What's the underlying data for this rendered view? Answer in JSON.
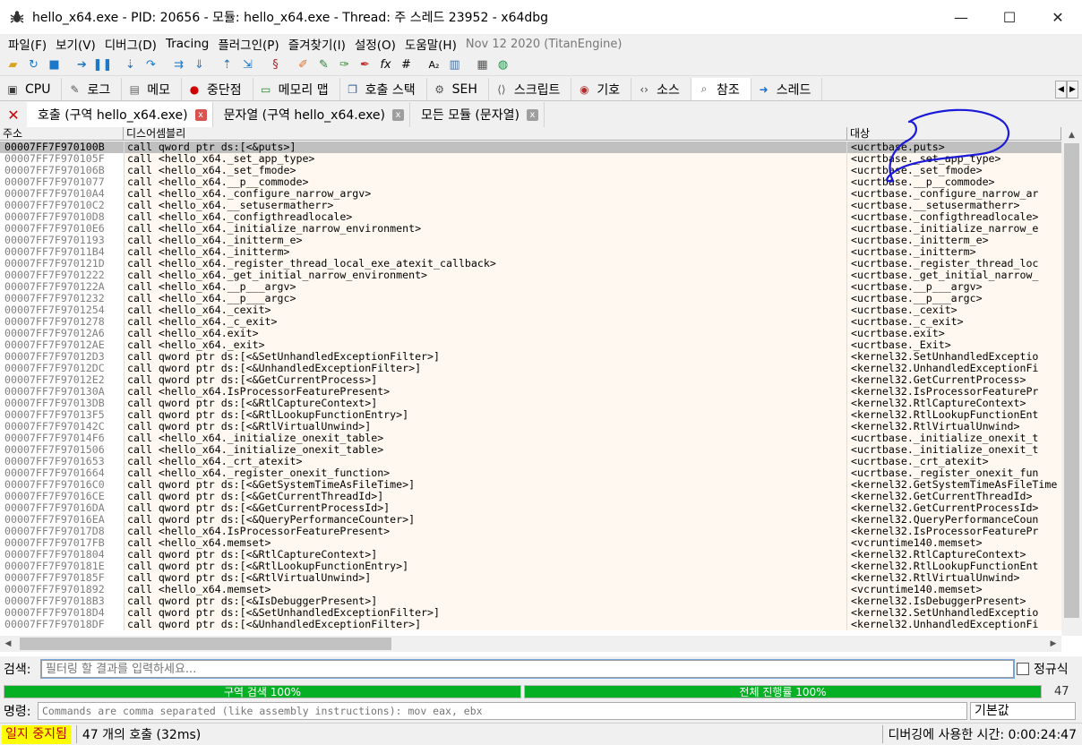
{
  "window": {
    "title": "hello_x64.exe - PID: 20656 - 모듈: hello_x64.exe - Thread: 주 스레드 23952 - x64dbg",
    "minimize": "—",
    "maximize": "☐",
    "close": "✕"
  },
  "menu": {
    "items": [
      "파일(F)",
      "보기(V)",
      "디버그(D)",
      "Tracing",
      "플러그인(P)",
      "즐겨찾기(I)",
      "설정(O)",
      "도움말(H)"
    ],
    "build": "Nov 12 2020 (TitanEngine)"
  },
  "main_tabs": [
    {
      "label": "CPU",
      "icon": "cpu-icon",
      "glyph": "▣",
      "color": "#3a3a3a"
    },
    {
      "label": "로그",
      "icon": "log-icon",
      "glyph": "✎",
      "color": "#555"
    },
    {
      "label": "메모",
      "icon": "notes-icon",
      "glyph": "▤",
      "color": "#666"
    },
    {
      "label": "중단점",
      "icon": "breakpoint-icon",
      "glyph": "●",
      "color": "#d00000"
    },
    {
      "label": "메모리 맵",
      "icon": "memory-map-icon",
      "glyph": "▭",
      "color": "#2e7d32"
    },
    {
      "label": "호출 스택",
      "icon": "call-stack-icon",
      "glyph": "❐",
      "color": "#3060a0"
    },
    {
      "label": "SEH",
      "icon": "seh-icon",
      "glyph": "⚙",
      "color": "#555"
    },
    {
      "label": "스크립트",
      "icon": "script-icon",
      "glyph": "⟨⟩",
      "color": "#555"
    },
    {
      "label": "기호",
      "icon": "symbols-icon",
      "glyph": "◉",
      "color": "#b03030"
    },
    {
      "label": "소스",
      "icon": "source-icon",
      "glyph": "‹›",
      "color": "#444"
    },
    {
      "label": "참조",
      "icon": "references-icon",
      "glyph": "⌕",
      "color": "#555"
    },
    {
      "label": "스레드",
      "icon": "threads-icon",
      "glyph": "➜",
      "color": "#1e6fd0"
    }
  ],
  "sub_tabs": [
    {
      "label": "호출 (구역 hello_x64.exe)",
      "close": "x"
    },
    {
      "label": "문자열 (구역 hello_x64.exe)",
      "close": "x"
    },
    {
      "label": "모든 모듈 (문자열)",
      "close": "x"
    }
  ],
  "columns": {
    "address": "주소",
    "disassembly": "디스어셈블리",
    "target": "대상"
  },
  "rows": [
    {
      "a": "00007FF7F970100B",
      "d": "call qword ptr ds:[<&puts>]",
      "t": "<ucrtbase.puts>"
    },
    {
      "a": "00007FF7F970105F",
      "d": "call <hello_x64._set_app_type>",
      "t": "<ucrtbase._set_app_type>"
    },
    {
      "a": "00007FF7F970106B",
      "d": "call <hello_x64._set_fmode>",
      "t": "<ucrtbase._set_fmode>"
    },
    {
      "a": "00007FF7F9701077",
      "d": "call <hello_x64.__p__commode>",
      "t": "<ucrtbase.__p__commode>"
    },
    {
      "a": "00007FF7F97010A4",
      "d": "call <hello_x64._configure_narrow_argv>",
      "t": "<ucrtbase._configure_narrow_ar"
    },
    {
      "a": "00007FF7F97010C2",
      "d": "call <hello_x64.__setusermatherr>",
      "t": "<ucrtbase.__setusermatherr>"
    },
    {
      "a": "00007FF7F97010D8",
      "d": "call <hello_x64._configthreadlocale>",
      "t": "<ucrtbase._configthreadlocale>"
    },
    {
      "a": "00007FF7F97010E6",
      "d": "call <hello_x64._initialize_narrow_environment>",
      "t": "<ucrtbase._initialize_narrow_e"
    },
    {
      "a": "00007FF7F9701193",
      "d": "call <hello_x64._initterm_e>",
      "t": "<ucrtbase._initterm_e>"
    },
    {
      "a": "00007FF7F97011B4",
      "d": "call <hello_x64._initterm>",
      "t": "<ucrtbase._initterm>"
    },
    {
      "a": "00007FF7F970121D",
      "d": "call <hello_x64._register_thread_local_exe_atexit_callback>",
      "t": "<ucrtbase._register_thread_loc"
    },
    {
      "a": "00007FF7F9701222",
      "d": "call <hello_x64._get_initial_narrow_environment>",
      "t": "<ucrtbase._get_initial_narrow_"
    },
    {
      "a": "00007FF7F970122A",
      "d": "call <hello_x64.__p___argv>",
      "t": "<ucrtbase.__p___argv>"
    },
    {
      "a": "00007FF7F9701232",
      "d": "call <hello_x64.__p___argc>",
      "t": "<ucrtbase.__p___argc>"
    },
    {
      "a": "00007FF7F9701254",
      "d": "call <hello_x64._cexit>",
      "t": "<ucrtbase._cexit>"
    },
    {
      "a": "00007FF7F9701278",
      "d": "call <hello_x64._c_exit>",
      "t": "<ucrtbase._c_exit>"
    },
    {
      "a": "00007FF7F97012A6",
      "d": "call <hello_x64.exit>",
      "t": "<ucrtbase.exit>"
    },
    {
      "a": "00007FF7F97012AE",
      "d": "call <hello_x64._exit>",
      "t": "<ucrtbase._Exit>"
    },
    {
      "a": "00007FF7F97012D3",
      "d": "call qword ptr ds:[<&SetUnhandledExceptionFilter>]",
      "t": "<kernel32.SetUnhandledExceptio"
    },
    {
      "a": "00007FF7F97012DC",
      "d": "call qword ptr ds:[<&UnhandledExceptionFilter>]",
      "t": "<kernel32.UnhandledExceptionFi"
    },
    {
      "a": "00007FF7F97012E2",
      "d": "call qword ptr ds:[<&GetCurrentProcess>]",
      "t": "<kernel32.GetCurrentProcess>"
    },
    {
      "a": "00007FF7F970130A",
      "d": "call <hello_x64.IsProcessorFeaturePresent>",
      "t": "<kernel32.IsProcessorFeaturePr"
    },
    {
      "a": "00007FF7F97013DB",
      "d": "call qword ptr ds:[<&RtlCaptureContext>]",
      "t": "<kernel32.RtlCaptureContext>"
    },
    {
      "a": "00007FF7F97013F5",
      "d": "call qword ptr ds:[<&RtlLookupFunctionEntry>]",
      "t": "<kernel32.RtlLookupFunctionEnt"
    },
    {
      "a": "00007FF7F970142C",
      "d": "call qword ptr ds:[<&RtlVirtualUnwind>]",
      "t": "<kernel32.RtlVirtualUnwind>"
    },
    {
      "a": "00007FF7F97014F6",
      "d": "call <hello_x64._initialize_onexit_table>",
      "t": "<ucrtbase._initialize_onexit_t"
    },
    {
      "a": "00007FF7F9701506",
      "d": "call <hello_x64._initialize_onexit_table>",
      "t": "<ucrtbase._initialize_onexit_t"
    },
    {
      "a": "00007FF7F9701653",
      "d": "call <hello_x64._crt_atexit>",
      "t": "<ucrtbase._crt_atexit>"
    },
    {
      "a": "00007FF7F9701664",
      "d": "call <hello_x64._register_onexit_function>",
      "t": "<ucrtbase._register_onexit_fun"
    },
    {
      "a": "00007FF7F97016C0",
      "d": "call qword ptr ds:[<&GetSystemTimeAsFileTime>]",
      "t": "<kernel32.GetSystemTimeAsFileTime"
    },
    {
      "a": "00007FF7F97016CE",
      "d": "call qword ptr ds:[<&GetCurrentThreadId>]",
      "t": "<kernel32.GetCurrentThreadId>"
    },
    {
      "a": "00007FF7F97016DA",
      "d": "call qword ptr ds:[<&GetCurrentProcessId>]",
      "t": "<kernel32.GetCurrentProcessId>"
    },
    {
      "a": "00007FF7F97016EA",
      "d": "call qword ptr ds:[<&QueryPerformanceCounter>]",
      "t": "<kernel32.QueryPerformanceCoun"
    },
    {
      "a": "00007FF7F97017D8",
      "d": "call <hello_x64.IsProcessorFeaturePresent>",
      "t": "<kernel32.IsProcessorFeaturePr"
    },
    {
      "a": "00007FF7F97017FB",
      "d": "call <hello_x64.memset>",
      "t": "<vcruntime140.memset>"
    },
    {
      "a": "00007FF7F9701804",
      "d": "call qword ptr ds:[<&RtlCaptureContext>]",
      "t": "<kernel32.RtlCaptureContext>"
    },
    {
      "a": "00007FF7F970181E",
      "d": "call qword ptr ds:[<&RtlLookupFunctionEntry>]",
      "t": "<kernel32.RtlLookupFunctionEnt"
    },
    {
      "a": "00007FF7F970185F",
      "d": "call qword ptr ds:[<&RtlVirtualUnwind>]",
      "t": "<kernel32.RtlVirtualUnwind>"
    },
    {
      "a": "00007FF7F9701892",
      "d": "call <hello_x64.memset>",
      "t": "<vcruntime140.memset>"
    },
    {
      "a": "00007FF7F97018B3",
      "d": "call qword ptr ds:[<&IsDebuggerPresent>]",
      "t": "<kernel32.IsDebuggerPresent>"
    },
    {
      "a": "00007FF7F97018D4",
      "d": "call qword ptr ds:[<&SetUnhandledExceptionFilter>]",
      "t": "<kernel32.SetUnhandledExceptio"
    },
    {
      "a": "00007FF7F97018DF",
      "d": "call qword ptr ds:[<&UnhandledExceptionFilter>]",
      "t": "<kernel32.UnhandledExceptionFi"
    }
  ],
  "search": {
    "label": "검색:",
    "placeholder": "필터링 할 결과를 입력하세요...",
    "regex_label": "정규식"
  },
  "progress": {
    "left_label": "구역 검색 100%",
    "right_label": "전체 진행률 100%",
    "count": "47",
    "color": "#06b025"
  },
  "command": {
    "label": "명령:",
    "placeholder": "Commands are comma separated (like assembly instructions): mov eax, ebx",
    "engine": "기본값"
  },
  "status": {
    "state": "일지 중지됨",
    "message": "47 개의 호출 (32ms)",
    "time": "디버깅에 사용한 시간: 0:00:24:47"
  }
}
